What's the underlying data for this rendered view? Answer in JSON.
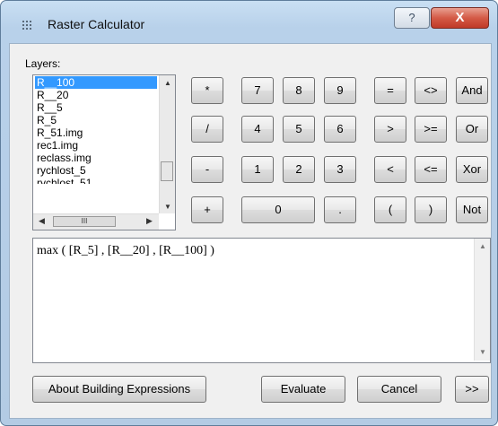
{
  "window": {
    "title": "Raster Calculator",
    "help_label": "?",
    "close_label": "X"
  },
  "layers": {
    "label": "Layers:",
    "items": [
      "R__100",
      "R__20",
      "R__5",
      "R_5",
      "R_51.img",
      "rec1.img",
      "reclass.img",
      "rychlost_5",
      "rychlost_51..."
    ],
    "selected": "R__100",
    "hscroll_glyph": "III"
  },
  "keypad": {
    "row1": [
      "*",
      "7",
      "8",
      "9",
      "=",
      "<>",
      "And"
    ],
    "row2": [
      "/",
      "4",
      "5",
      "6",
      ">",
      ">=",
      "Or"
    ],
    "row3": [
      "-",
      "1",
      "2",
      "3",
      "<",
      "<=",
      "Xor"
    ],
    "row4": [
      "+",
      "0",
      ".",
      "(",
      ")",
      "Not"
    ]
  },
  "expression": {
    "value": "max ( [R_5] , [R__20] , [R__100] )"
  },
  "buttons": {
    "about": "About Building Expressions",
    "evaluate": "Evaluate",
    "cancel": "Cancel",
    "more": ">>"
  }
}
